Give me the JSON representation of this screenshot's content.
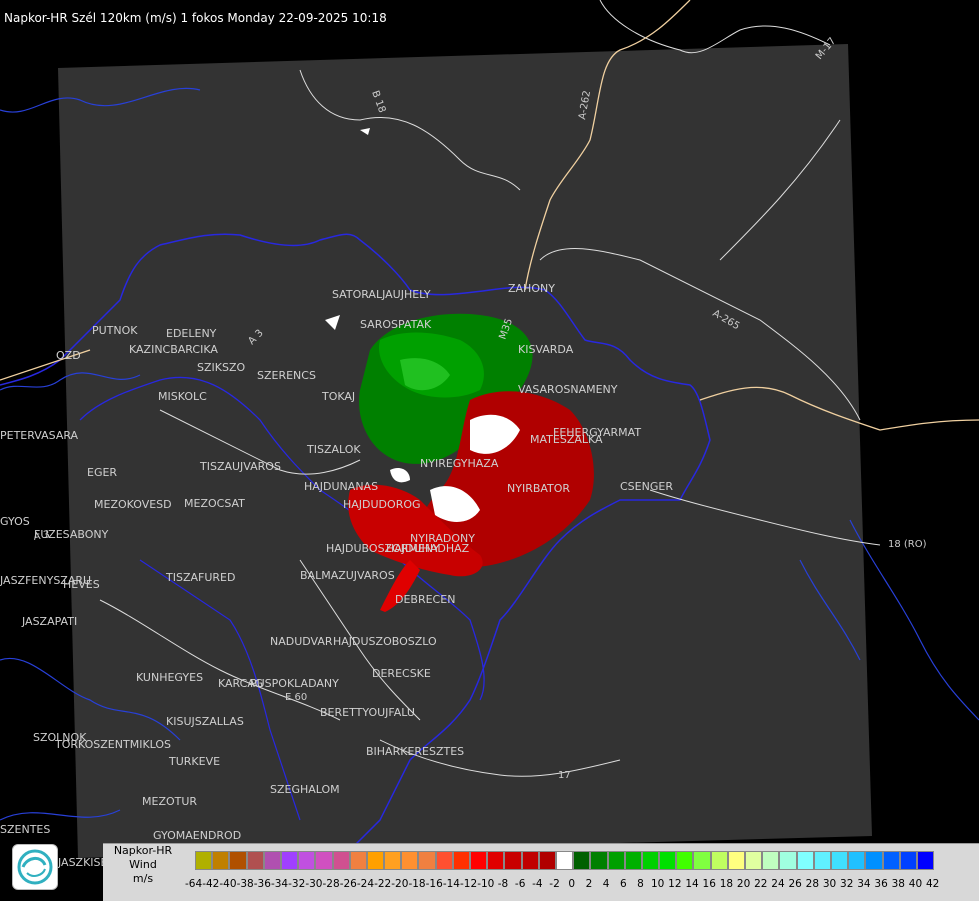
{
  "title": "Napkor-HR Szél 120km (m/s) 1 fokos Monday 22-09-2025 10:18",
  "cities": [
    "SATORALJAUJHELY",
    "SAROSPATAK",
    "ZAHONY",
    "PUTNOK",
    "EDELENY",
    "KAZINCBARCIKA",
    "SZIKSZO",
    "SZERENCS",
    "MISKOLC",
    "TOKAJ",
    "KISVARDA",
    "FEHERGYARMAT",
    "MATESZALKA",
    "VASAROSNAMENY",
    "NYIREGYHAZA",
    "TISZALOK",
    "TISZAUJVAROS",
    "NYIRBATOR",
    "CSENGER",
    "EGER",
    "HAJDUNANAS",
    "HAJDUDOROG",
    "MEZOKOVESD",
    "MEZOCSAT",
    "HAJDUBOSZORMENY",
    "HAJDUHADHAZ",
    "NYIRADONY",
    "FUZESABONY",
    "BALMAZUJVAROS",
    "TISZAFURED",
    "HEVES",
    "DEBRECEN",
    "JASZAPATI",
    "NADUDVAR",
    "HAJDUSZOBOSZLO",
    "KUNHEGYES",
    "KARCAG",
    "PUSPOKLADANY",
    "DERECSKE",
    "KISUJSZALLAS",
    "BERETTYOUJFALU",
    "SZOLNOK",
    "TORKOSZENTMIKLOS",
    "TURKEVE",
    "BIHARKERESZTES",
    "SZEGHALOM",
    "MEZOTUR",
    "GYOMAENDROD",
    "PETERVASARA",
    "OZD",
    "GYOS",
    "JASZFENYSZARU",
    "SZENTES",
    "JASZKISER"
  ],
  "roads": [
    "B 18",
    "A-262",
    "M-17",
    "A-265",
    "A 3",
    "A 3",
    "18 (RO)",
    "E 60",
    "17",
    "M35"
  ],
  "legend": {
    "product": "Napkor-HR",
    "quantity": "Wind",
    "unit": "m/s",
    "values": [
      "-64",
      "-42",
      "-40",
      "-38",
      "-36",
      "-34",
      "-32",
      "-30",
      "-28",
      "-26",
      "-24",
      "-22",
      "-20",
      "-18",
      "-16",
      "-14",
      "-12",
      "-10",
      "-8",
      "-6",
      "-4",
      "-2",
      "0",
      "2",
      "4",
      "6",
      "8",
      "10",
      "12",
      "14",
      "16",
      "18",
      "20",
      "22",
      "24",
      "26",
      "28",
      "30",
      "32",
      "34",
      "36",
      "38",
      "40",
      "42"
    ],
    "colors": [
      "#b0b000",
      "#c08000",
      "#b05000",
      "#b05050",
      "#b050b0",
      "#a040ff",
      "#c050e0",
      "#d050c0",
      "#d05090",
      "#f08040",
      "#ffa000",
      "#ffa020",
      "#ff9030",
      "#f08040",
      "#ff5030",
      "#ff3000",
      "#ff0000",
      "#e00000",
      "#c80000",
      "#c00000",
      "#b00000",
      "#ffffff",
      "#006000",
      "#008000",
      "#00a000",
      "#00b000",
      "#00d000",
      "#00e000",
      "#40ff00",
      "#80ff40",
      "#c0ff60",
      "#ffff80",
      "#e0ffa0",
      "#c0ffc0",
      "#a0ffe0",
      "#80ffff",
      "#60f0ff",
      "#40e0ff",
      "#20c0ff",
      "#0090ff",
      "#0060ff",
      "#0040ff",
      "#0000ff"
    ]
  },
  "colors": {
    "background": "#000000",
    "radar_area": "#333333",
    "border": "#2222dd",
    "road": "#f0d0a0"
  }
}
